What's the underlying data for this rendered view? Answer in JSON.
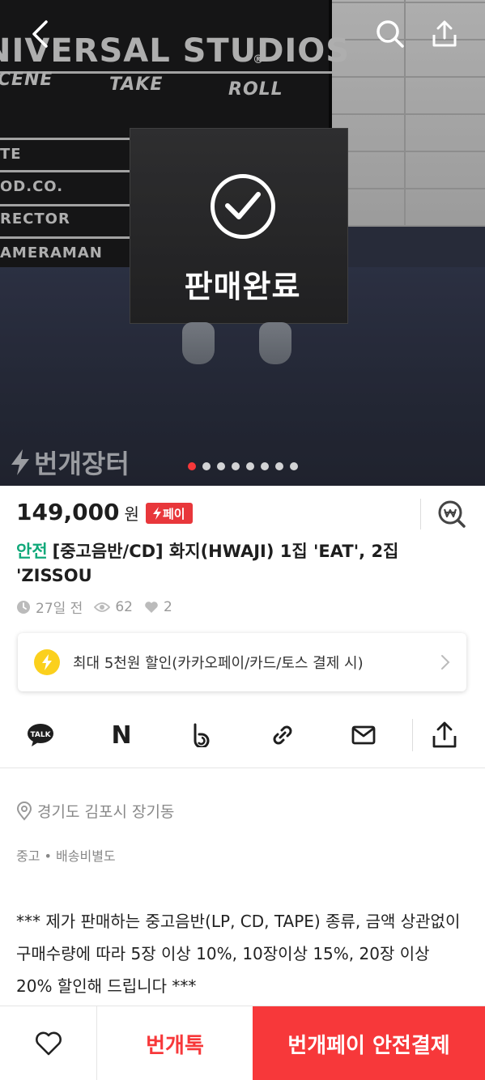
{
  "hero": {
    "clapper_texts": [
      "NIVERSAL STUDIOS",
      "®",
      "SCENE",
      "TAKE",
      "ROLL",
      "TE",
      "OD.CO.",
      "RECTOR",
      "AMERAMAN"
    ],
    "sold_label": "판매완료",
    "watermark": "번개장터",
    "page_count": 8,
    "current_page": 1
  },
  "product": {
    "price": "149,000",
    "currency": "원",
    "pay_badge": "페이",
    "safe_tag": "안전",
    "title": "[중고음반/CD] 화지(HWAJI) 1집 'EAT', 2집 'ZISSOU",
    "time_ago": "27일 전",
    "views": "62",
    "likes": "2"
  },
  "promo": {
    "text": "최대 5천원 할인(카카오페이/카드/토스 결제 시)"
  },
  "share": {
    "talk_label": "TALK",
    "naver_label": "N"
  },
  "details": {
    "location": "경기도 김포시 장기동",
    "condition": "중고 • 배송비별도",
    "description": "*** 제가 판매하는 중고음반(LP, CD, TAPE) 종류, 금액 상관없이 구매수량에 따라 5장 이상 10%, 10장이상 15%, 20장 이상 20% 할인해 드립니다 ***"
  },
  "bottom": {
    "chat_label": "번개톡",
    "pay_label": "번개페이 안전결제"
  },
  "colors": {
    "accent_red": "#f7383a",
    "safe_green": "#11a97a",
    "promo_yellow": "#fbd01d"
  },
  "icons": [
    "back-icon",
    "search-icon",
    "share-icon",
    "check-icon",
    "lightning-icon",
    "price-check-icon",
    "clock-icon",
    "eye-icon",
    "heart-icon",
    "chevron-right-icon",
    "kakaotalk-icon",
    "naver-icon",
    "band-icon",
    "link-icon",
    "mail-icon",
    "location-icon"
  ]
}
